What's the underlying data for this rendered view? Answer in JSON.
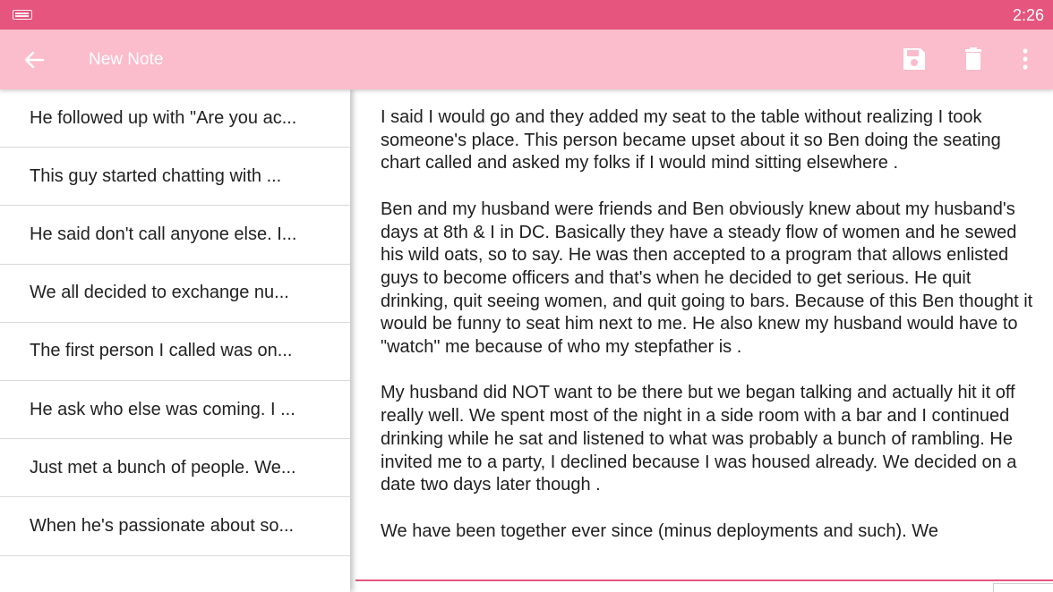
{
  "status_bar": {
    "time": "2:26",
    "keyboard_icon": "keyboard-icon"
  },
  "app_bar": {
    "title": "New Note",
    "back_icon": "arrow-back-icon",
    "actions": [
      "save-icon",
      "delete-icon",
      "more-vert-icon"
    ]
  },
  "notes_list": [
    {
      "preview": "He followed up with \"Are you ac..."
    },
    {
      "preview": "This guy started chatting with ..."
    },
    {
      "preview": "He said don't call anyone else. I..."
    },
    {
      "preview": "We all decided to exchange nu..."
    },
    {
      "preview": "The first person I called was on..."
    },
    {
      "preview": "He ask who else was coming. I ..."
    },
    {
      "preview": "Just met a bunch of people. We..."
    },
    {
      "preview": "When he's passionate about so..."
    }
  ],
  "editor": {
    "paragraphs": [
      "I said I would go and they added my seat to the table without realizing I took someone's place. This person became upset about it so Ben doing the seating chart called and asked my folks if I would mind sitting elsewhere .",
      "Ben and my husband were friends and Ben obviously knew about my husband's days at 8th & I in DC. Basically they have a steady flow of women and he sewed his wild oats, so to say. He was then accepted to a program that allows enlisted guys to become officers and that's when he decided to get serious. He quit drinking, quit seeing women, and quit going to bars. Because of this Ben thought it would be funny to seat him next to me. He also knew my husband would have to \"watch\" me because of who my stepfather is .",
      "My husband did NOT want to be there but we began talking and actually hit it off really well. We spent most of the night in a side room with a bar and I continued drinking while he sat and listened to what was probably a bunch of rambling. He invited me to a party, I declined because I was housed already. We decided on a date two days later though .",
      "We have been together ever since (minus deployments and such). We"
    ]
  },
  "colors": {
    "status_bar": "#e5557e",
    "app_bar": "#fbbccb",
    "accent": "#e5557e"
  }
}
